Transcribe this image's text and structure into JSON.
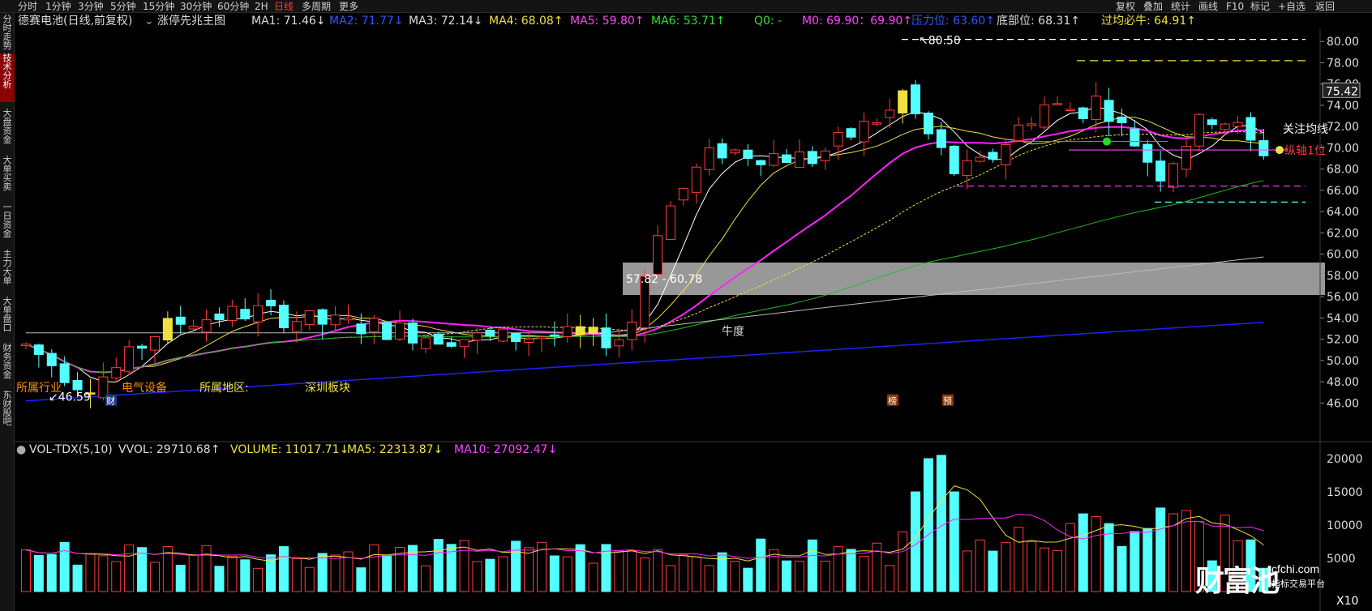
{
  "toolbar": {
    "timeframes": [
      "分时",
      "1分钟",
      "3分钟",
      "5分钟",
      "15分钟",
      "30分钟",
      "60分钟",
      "2H",
      "日线",
      "多周期",
      "更多"
    ],
    "active_timeframe": "日线",
    "right_items": [
      "复权",
      "叠加",
      "统计",
      "画线",
      "F10",
      "标记",
      "+自选",
      "返回"
    ]
  },
  "sidebar": {
    "items": [
      "分时走势",
      "技术分析",
      "大盘资金",
      "大单买卖",
      "一日资金",
      "主力大单",
      "大单盘口",
      "财务资金",
      "东财股吧"
    ],
    "active": "技术分析"
  },
  "info": {
    "stock": "德赛电池(日线,前复权)",
    "indicator": "涨停先兆主图",
    "ma1": "MA1: 71.46↓",
    "ma2": "MA2: 71.77↓",
    "ma3": "MA3: 72.14↓",
    "ma4": "MA4: 68.08↑",
    "ma5": "MA5: 59.80↑",
    "ma6": "MA6: 53.71↑",
    "q0": "Q0: -",
    "m0": "M0: 69.90：69.90↑",
    "pressure": "压力位: 63.60↑",
    "bottom": "底部位: 68.31↑",
    "must_rise": "过均必牛: 64.91↑"
  },
  "main_chart": {
    "price_axis": [
      "80.00",
      "78.00",
      "76.00",
      "74.00",
      "72.00",
      "70.00",
      "68.00",
      "66.00",
      "64.00",
      "62.00",
      "60.00",
      "58.00",
      "56.00",
      "54.00",
      "52.00",
      "50.00",
      "48.00",
      "46.00"
    ],
    "current_price": "75.42",
    "annotations": {
      "high": "80.50",
      "low": "46.59",
      "gap": "57.82 - 60.78",
      "niudu": "牛度",
      "focus_line": "关注均线",
      "axis_line": "纵轴1位",
      "industry_label": "所属行业",
      "industry": "电气设备",
      "region_label": "所属地区:",
      "region": "深圳板块",
      "mark_bang": "榜",
      "mark_yu": "预",
      "mark_cai": "财"
    }
  },
  "volume_panel": {
    "title": "VOL-TDX(5,10)",
    "vvol": "VVOL: 29710.68↑",
    "volume": "VOLUME: 11017.71↓",
    "ma5": "MA5: 22313.87↓",
    "ma10": "MA10: 27092.47↓",
    "axis": [
      "20000",
      "15000",
      "10000",
      "5000"
    ],
    "multiplier": "X10"
  },
  "watermark": {
    "brand": "财富池",
    "site": "cfchi.com",
    "tagline": "指标交易平台"
  },
  "colors": {
    "up": "#ff3b3b",
    "down": "#54ffff",
    "ma_white": "#ffffff",
    "ma_yellow": "#f0e040",
    "ma_magenta": "#ff22ff",
    "ma_green": "#22bb22",
    "ma_blue": "#2020ff",
    "band_gray": "#a0a0a0"
  }
}
